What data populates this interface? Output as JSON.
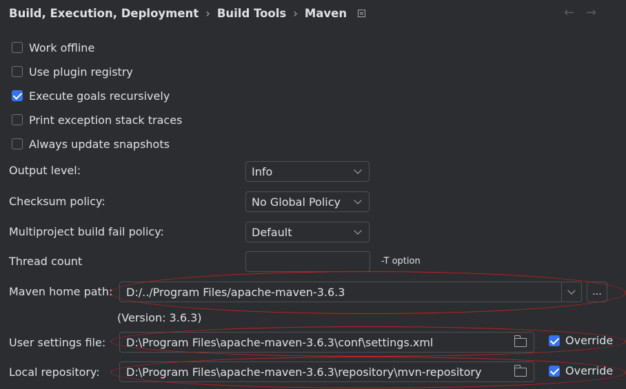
{
  "breadcrumb": {
    "items": [
      "Build, Execution, Deployment",
      "Build Tools",
      "Maven"
    ],
    "separator": "›",
    "page_icon": "settings-page-icon"
  },
  "nav": {
    "back": "←",
    "forward": "→"
  },
  "checkboxes": [
    {
      "label": "Work offline",
      "checked": false
    },
    {
      "label": "Use plugin registry",
      "checked": false
    },
    {
      "label": "Execute goals recursively",
      "checked": true
    },
    {
      "label": "Print exception stack traces",
      "checked": false
    },
    {
      "label": "Always update snapshots",
      "checked": false
    }
  ],
  "output_level": {
    "label": "Output level:",
    "value": "Info"
  },
  "checksum_policy": {
    "label": "Checksum policy:",
    "value": "No Global Policy"
  },
  "multiproject_policy": {
    "label": "Multiproject build fail policy:",
    "value": "Default"
  },
  "thread_count": {
    "label": "Thread count",
    "value": "",
    "hint": "-T option"
  },
  "maven_home": {
    "label": "Maven home path:",
    "value": "D:/../Program Files/apache-maven-3.6.3",
    "browse": "...",
    "version": "(Version: 3.6.3)"
  },
  "user_settings": {
    "label": "User settings file:",
    "value": "D:\\Program Files\\apache-maven-3.6.3\\conf\\settings.xml",
    "override_label": "Override",
    "override_checked": true
  },
  "local_repo": {
    "label": "Local repository:",
    "value": "D:\\Program Files\\apache-maven-3.6.3\\repository\\mvn-repository",
    "override_label": "Override",
    "override_checked": true
  },
  "colors": {
    "background": "#2b2d30",
    "text": "#dfe1e5",
    "accent": "#3574f0",
    "annotation": "#cc1f1f"
  }
}
